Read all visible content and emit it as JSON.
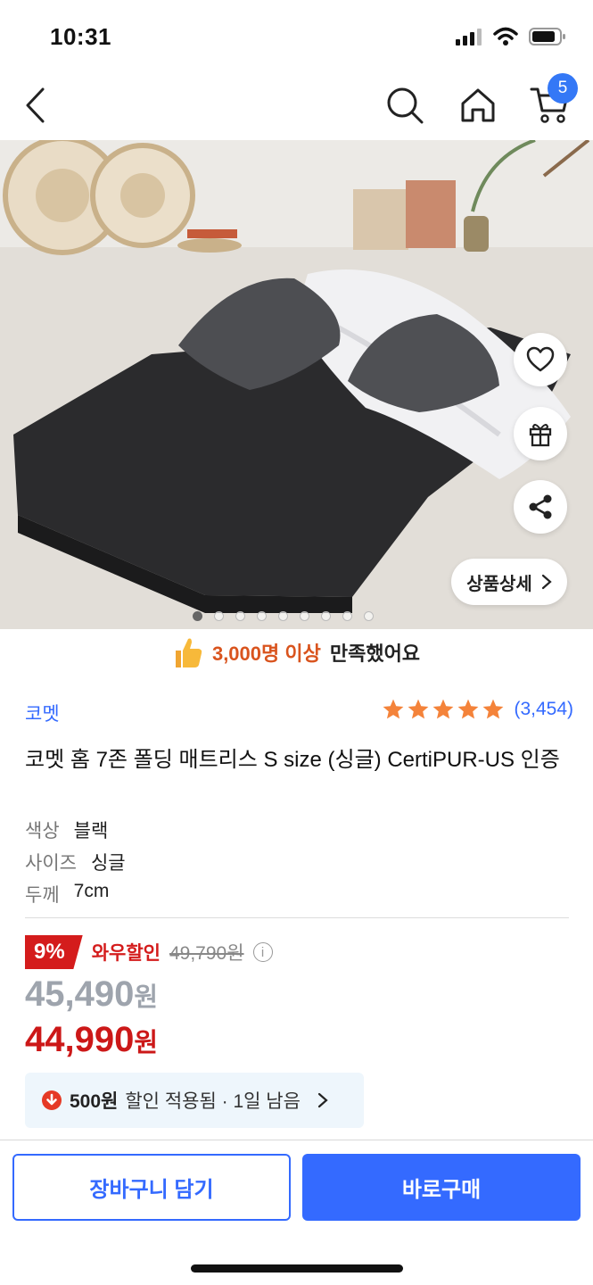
{
  "status": {
    "time": "10:31"
  },
  "nav": {
    "cart_count": "5"
  },
  "hero": {
    "detail_label": "상품상세",
    "dots_total": 9,
    "dot_active": 0
  },
  "satisfaction": {
    "count": "3,000명 이상",
    "rest": "만족했어요"
  },
  "product": {
    "brand": "코멧",
    "rating": 5,
    "rating_count": "(3,454)",
    "title": "코멧 홈 7존 폴딩 매트리스 S size (싱글) CertiPUR-US 인증",
    "options": [
      {
        "key": "색상",
        "value": "블랙"
      },
      {
        "key": "사이즈",
        "value": "싱글"
      },
      {
        "key": "두께",
        "value": "7cm"
      }
    ]
  },
  "pricing": {
    "discount_pct": "9%",
    "discount_label": "와우할인",
    "original_price": "49,790원",
    "price1": "45,490",
    "price1_unit": "원",
    "price2": "44,990",
    "price2_unit": "원"
  },
  "coupon": {
    "amount": "500원",
    "text": "할인 적용됨 · 1일 남음"
  },
  "actions": {
    "cart": "장바구니 담기",
    "buy": "바로구매"
  },
  "colors": {
    "accent": "#346aff",
    "sale_red": "#cc1818",
    "star": "#f4833a"
  }
}
